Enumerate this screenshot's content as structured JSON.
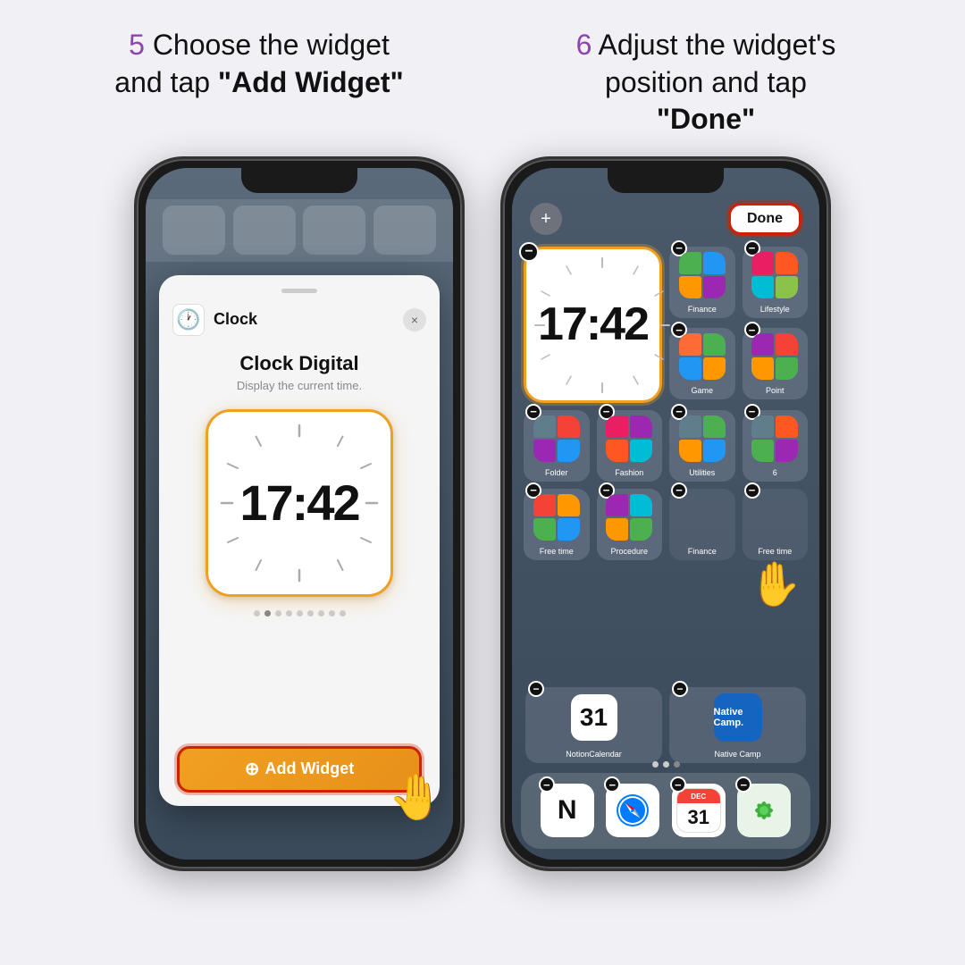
{
  "background_color": "#f0f0f5",
  "step5": {
    "number": "5",
    "text_part1": " Choose the widget",
    "text_part2": "and tap ",
    "bold_text": "\"Add Widget\""
  },
  "step6": {
    "number": "6",
    "text_part1": " Adjust the widget's",
    "text_part2": "position and tap",
    "bold_text": "\"Done\""
  },
  "phone1": {
    "sheet_handle": "",
    "clock_icon": "🕐",
    "app_name": "Clock",
    "close_x": "×",
    "widget_title": "Clock Digital",
    "widget_desc": "Display the current time.",
    "clock_time": "17:42",
    "dots": [
      false,
      true,
      false,
      false,
      false,
      false,
      false,
      false,
      false
    ],
    "add_widget_label": "Add Widget"
  },
  "phone2": {
    "plus_label": "+",
    "done_label": "Done",
    "clock_time": "17:42",
    "apps": [
      {
        "label": "Finance",
        "type": "folder"
      },
      {
        "label": "Lifestyle",
        "type": "folder"
      },
      {
        "label": "Game",
        "type": "folder"
      },
      {
        "label": "Point",
        "type": "folder"
      },
      {
        "label": "Folder",
        "type": "folder"
      },
      {
        "label": "Fashion",
        "type": "folder"
      },
      {
        "label": "Utilities",
        "type": "folder"
      },
      {
        "label": "6",
        "type": "folder"
      },
      {
        "label": "Free time",
        "type": "folder"
      },
      {
        "label": "Procedure",
        "type": "folder"
      },
      {
        "label": "Finance",
        "type": "folder"
      },
      {
        "label": "Free time",
        "type": "folder"
      }
    ],
    "bottom_apps": [
      {
        "label": "NotionCalendar",
        "type": "notion"
      },
      {
        "label": "Native Camp",
        "type": "native"
      }
    ],
    "dock_apps": [
      {
        "label": "Notion",
        "type": "notion"
      },
      {
        "label": "Safari",
        "type": "safari"
      },
      {
        "label": "Calendar",
        "type": "calendar"
      },
      {
        "label": "Sparkle",
        "type": "sparkle"
      }
    ]
  },
  "accent_color": "#8e44ad",
  "orange_color": "#f0a020",
  "red_border_color": "#cc2200"
}
